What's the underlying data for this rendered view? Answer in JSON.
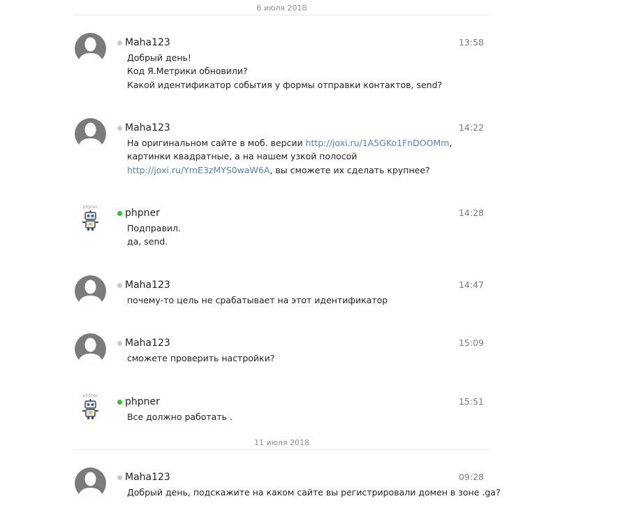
{
  "colors": {
    "link": "#5580b8",
    "online_status": "#2fc42b",
    "offline_status": "#c8c8c8",
    "date_text": "#8f8f8f",
    "time_text": "#7a7a7a"
  },
  "date_separators": [
    {
      "label": "6 июля 2018"
    },
    {
      "label": "11 июля 2018"
    }
  ],
  "messages": [
    {
      "author": "Maha123",
      "status": "offline",
      "avatar": "default-user-avatar",
      "time": "13:58",
      "lines": [
        "Добрый день!",
        "Код Я.Метрики обновили?",
        "Какой идентификатор события у формы отправки контактов, send?"
      ]
    },
    {
      "author": "Maha123",
      "status": "offline",
      "avatar": "default-user-avatar",
      "time": "14:22",
      "parts": [
        {
          "text": "На оригинальном сайте в моб. версии "
        },
        {
          "link": "http://joxi.ru/1A5GKo1FnDOOMm"
        },
        {
          "text": ", картинки квадратные, а на нашем узкой полосой "
        },
        {
          "link": "http://joxi.ru/YmE3zMYS0waW6A"
        },
        {
          "text": ", вы сможете их сделать крупнее?"
        }
      ]
    },
    {
      "author": "phpner",
      "status": "online",
      "avatar": "robot-avatar",
      "time": "14:28",
      "lines": [
        "Подправил.",
        "да, send."
      ]
    },
    {
      "author": "Maha123",
      "status": "offline",
      "avatar": "default-user-avatar",
      "time": "14:47",
      "lines": [
        "почему-то цель не срабатывает на этот идентификатор"
      ]
    },
    {
      "author": "Maha123",
      "status": "offline",
      "avatar": "default-user-avatar",
      "time": "15:09",
      "lines": [
        "сможете проверить настройки?"
      ]
    },
    {
      "author": "phpner",
      "status": "online",
      "avatar": "robot-avatar",
      "time": "15:51",
      "lines": [
        "Все должно работать ."
      ]
    },
    {
      "author": "Maha123",
      "status": "offline",
      "avatar": "default-user-avatar",
      "time": "09:28",
      "lines": [
        "Добрый день, подскажите на каком сайте вы регистрировали домен в зоне .ga?"
      ]
    }
  ]
}
